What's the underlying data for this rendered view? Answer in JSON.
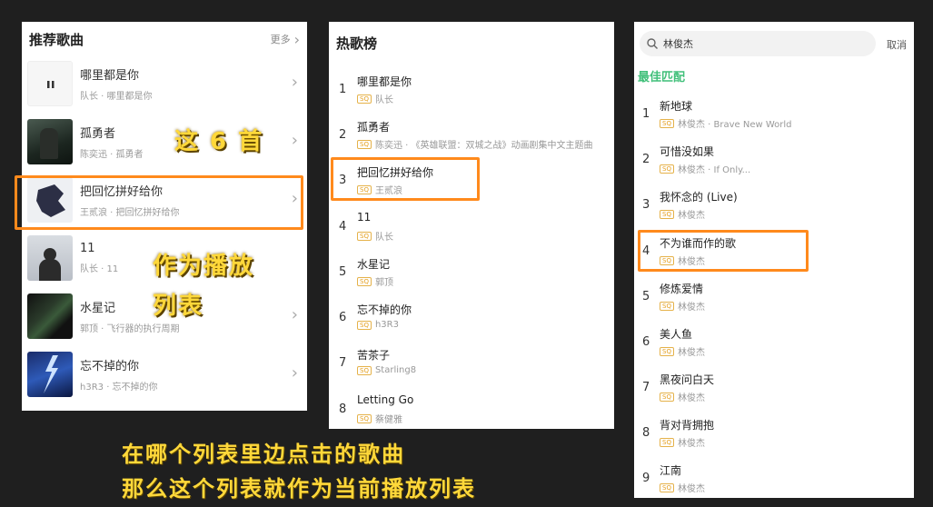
{
  "recommend": {
    "title": "推荐歌曲",
    "more_label": "更多",
    "songs": [
      {
        "title": "哪里都是你",
        "sub": "队长 · 哪里都是你"
      },
      {
        "title": "孤勇者",
        "sub": "陈奕迅 · 孤勇者"
      },
      {
        "title": "把回忆拼好给你",
        "sub": "王贰浪 · 把回忆拼好给你"
      },
      {
        "title": "11",
        "sub": "队长 · 11"
      },
      {
        "title": "水星记",
        "sub": "郭顶 · 飞行器的执行周期"
      },
      {
        "title": "忘不掉的你",
        "sub": "h3R3 · 忘不掉的你"
      }
    ]
  },
  "hot": {
    "title": "热歌榜",
    "badge": "SQ",
    "songs": [
      {
        "rank": "1",
        "title": "哪里都是你",
        "artist": "队长"
      },
      {
        "rank": "2",
        "title": "孤勇者",
        "artist": "陈奕迅 · 《英雄联盟：双城之战》动画剧集中文主题曲"
      },
      {
        "rank": "3",
        "title": "把回忆拼好给你",
        "artist": "王贰浪"
      },
      {
        "rank": "4",
        "title": "11",
        "artist": "队长"
      },
      {
        "rank": "5",
        "title": "水星记",
        "artist": "郭顶"
      },
      {
        "rank": "6",
        "title": "忘不掉的你",
        "artist": "h3R3"
      },
      {
        "rank": "7",
        "title": "苦茶子",
        "artist": "Starling8"
      },
      {
        "rank": "8",
        "title": "Letting Go",
        "artist": "蔡健雅"
      }
    ]
  },
  "search": {
    "query": "林俊杰",
    "cancel_label": "取消",
    "best_match_label": "最佳匹配",
    "badge": "SQ",
    "results": [
      {
        "rank": "1",
        "title": "新地球",
        "artist": "林俊杰 · Brave New World"
      },
      {
        "rank": "2",
        "title": "可惜没如果",
        "artist": "林俊杰 · If Only..."
      },
      {
        "rank": "3",
        "title": "我怀念的 (Live)",
        "artist": "林俊杰"
      },
      {
        "rank": "4",
        "title": "不为谁而作的歌",
        "artist": "林俊杰"
      },
      {
        "rank": "5",
        "title": "修炼爱情",
        "artist": "林俊杰"
      },
      {
        "rank": "6",
        "title": "美人鱼",
        "artist": "林俊杰"
      },
      {
        "rank": "7",
        "title": "黑夜问白天",
        "artist": "林俊杰"
      },
      {
        "rank": "8",
        "title": "背对背拥抱",
        "artist": "林俊杰"
      },
      {
        "rank": "9",
        "title": "江南",
        "artist": "林俊杰"
      }
    ]
  },
  "annotations": {
    "these_six": "这 6 首",
    "as_playlist_1": "作为播放",
    "as_playlist_2": "列表",
    "bottom_line1": "在哪个列表里边点击的歌曲",
    "bottom_line2": "那么这个列表就作为当前播放列表"
  },
  "icons": {
    "pause": "pause-icon",
    "chevron": "chevron-right-icon",
    "search": "search-icon"
  },
  "colors": {
    "highlight_box": "#ff8a1c",
    "annotation_text": "#ffd83a",
    "best_match": "#41c07a",
    "sq_badge": "#e5a020"
  }
}
